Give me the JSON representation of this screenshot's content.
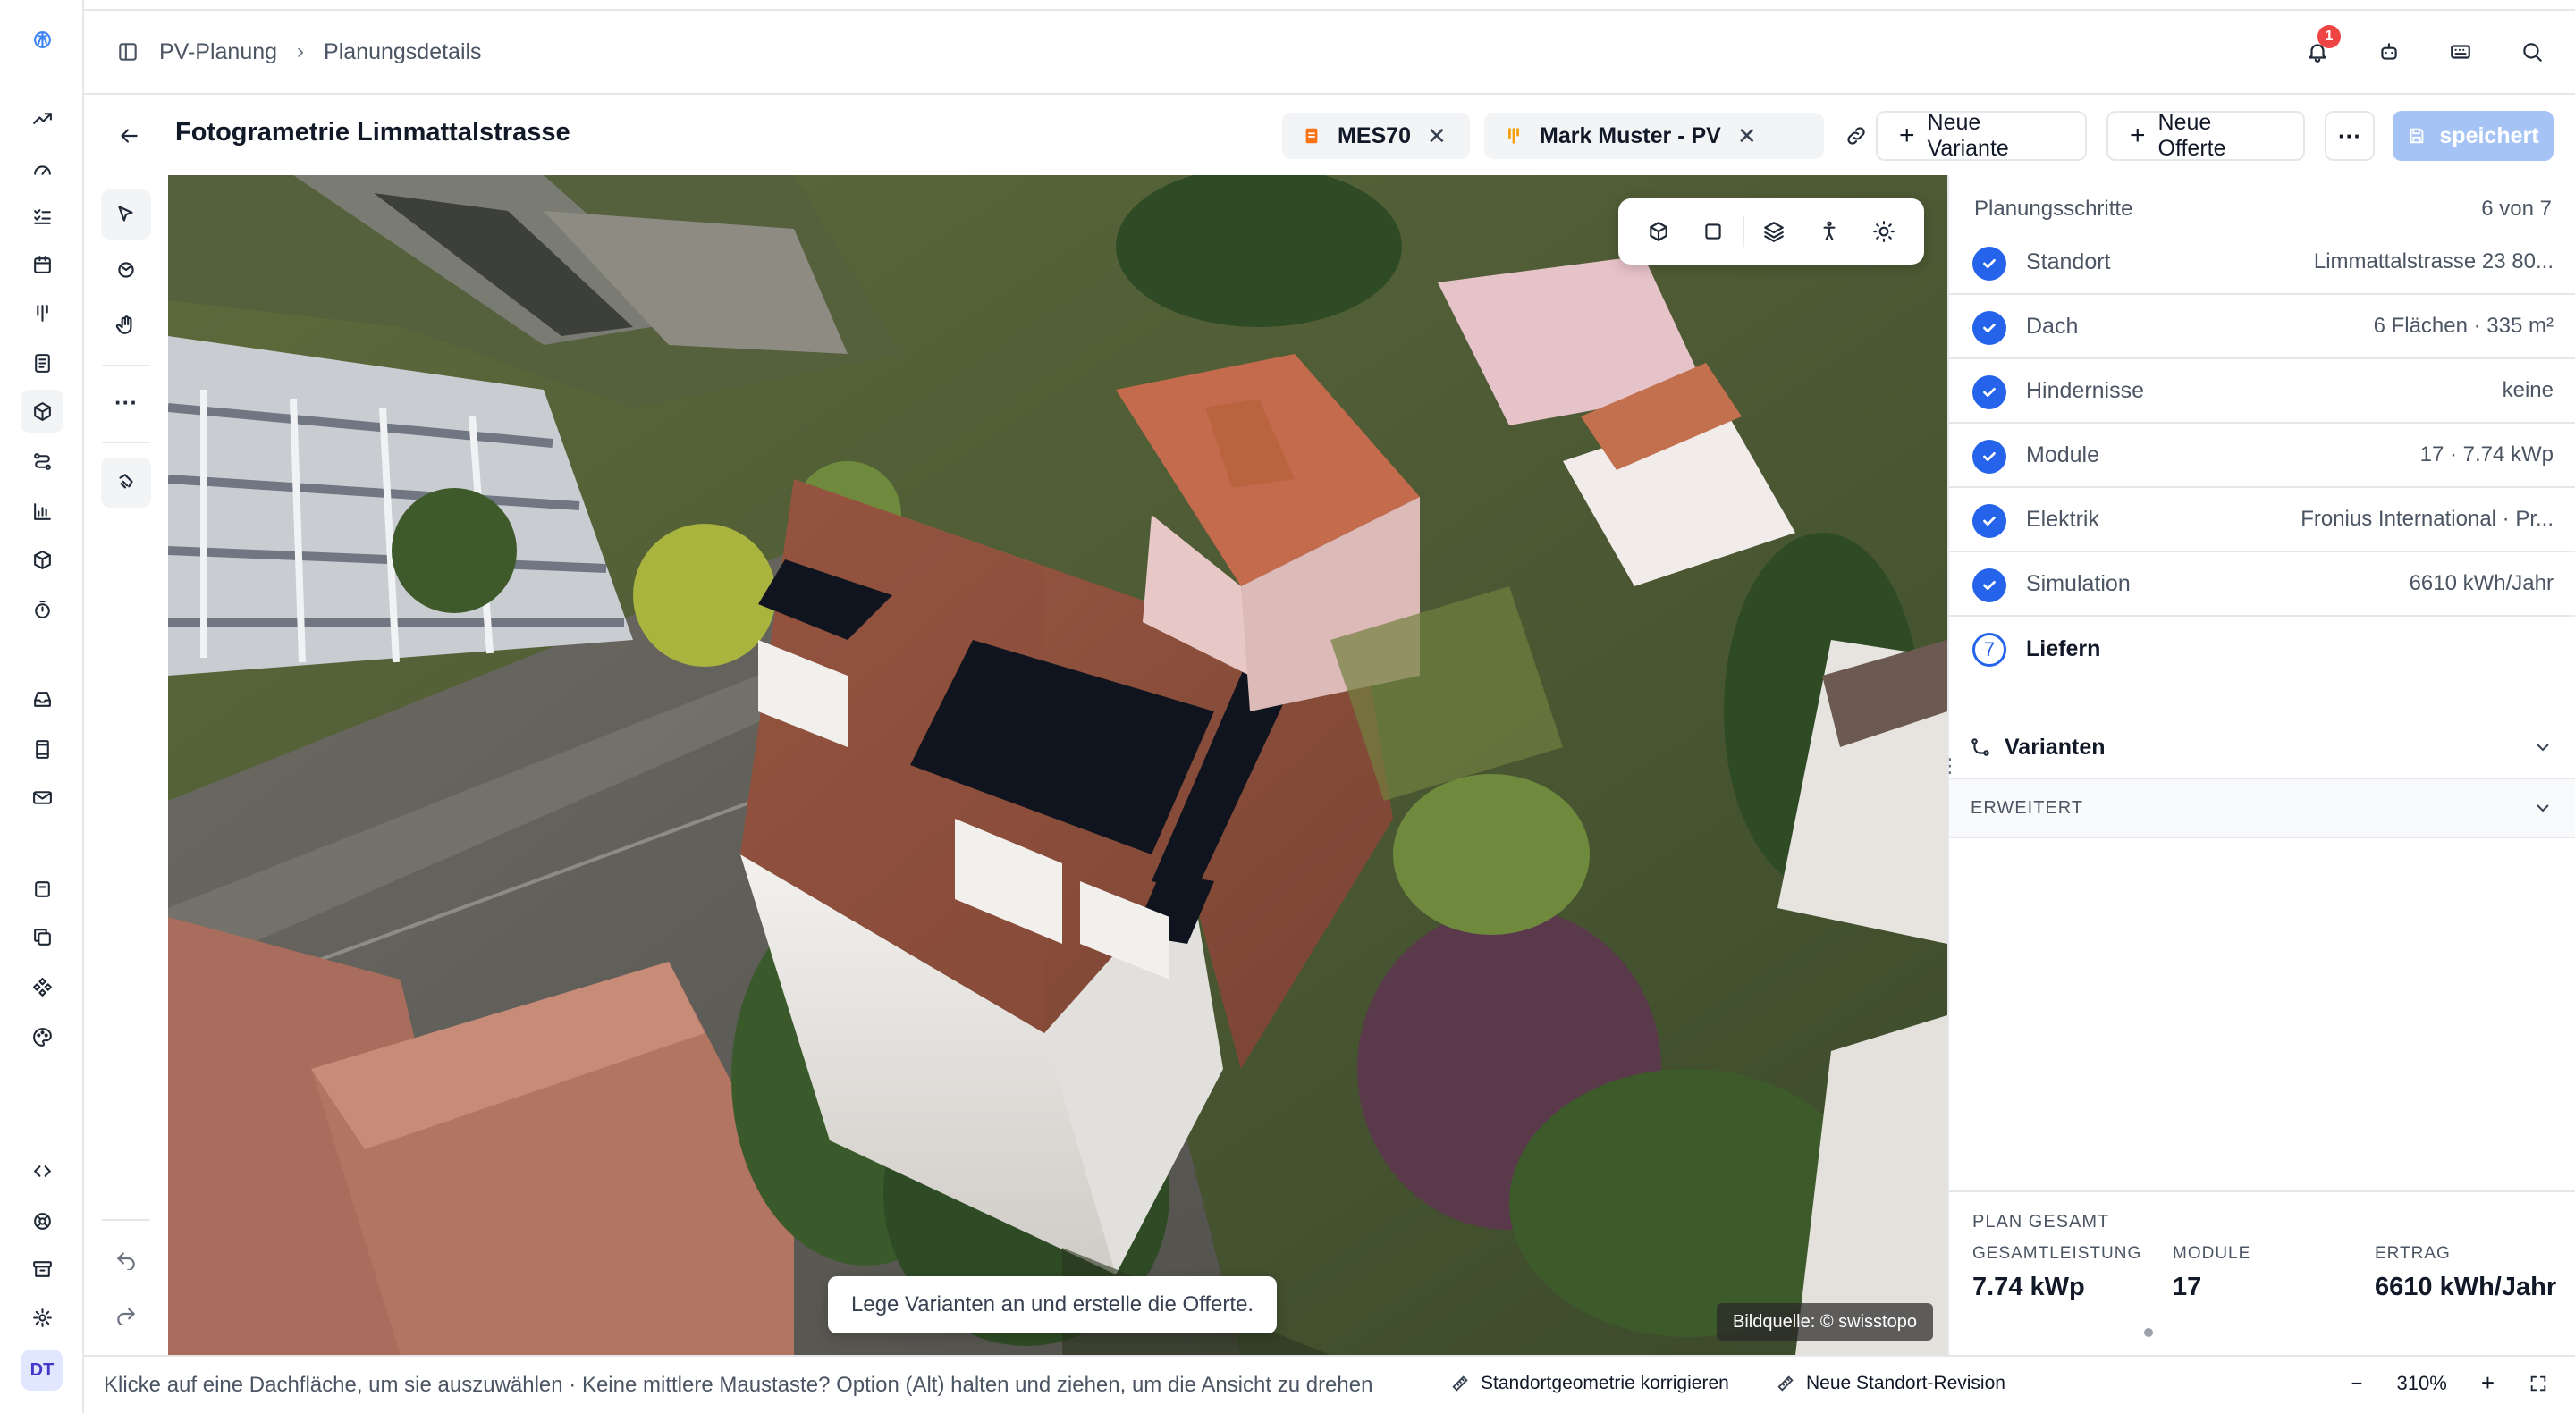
{
  "app": {
    "avatar_initials": "DT",
    "rail_icons": [
      "logo-icon",
      "trend-icon",
      "gauge-icon",
      "checklist-icon",
      "calendar-icon",
      "kanban-icon",
      "invoice-icon",
      "cube-icon",
      "route-icon",
      "chart-icon",
      "package-icon",
      "timer-icon",
      "inbox-icon",
      "film-icon",
      "mail-icon",
      "archive-box-icon",
      "copy-icon",
      "components-icon",
      "palette-icon",
      "code-icon",
      "help-icon",
      "archive-icon",
      "settings-icon"
    ]
  },
  "breadcrumb": {
    "items": [
      "PV-Planung",
      "Planungsdetails"
    ],
    "notification_count": "1"
  },
  "titlebar": {
    "title": "Fotogrametrie Limmattalstrasse",
    "chips": [
      {
        "label": "MES70"
      },
      {
        "label": "Mark Muster - PV"
      }
    ],
    "new_variant_label": "Neue Variante",
    "new_offer_label": "Neue Offerte",
    "more_label": "···",
    "save_label": "speichert"
  },
  "viewport": {
    "hint": "Lege Varianten an und erstelle die Offerte.",
    "credit": "Bildquelle: © swisstopo"
  },
  "panel": {
    "steps_title": "Planungsschritte",
    "steps_progress": "6 von 7",
    "steps": [
      {
        "label": "Standort",
        "value": "Limmattalstrasse 23 80..."
      },
      {
        "label": "Dach",
        "value": "6 Flächen · 335 m²"
      },
      {
        "label": "Hindernisse",
        "value": "keine"
      },
      {
        "label": "Module",
        "value": "17 · 7.74 kWp"
      },
      {
        "label": "Elektrik",
        "value": "Fronius International · Pr..."
      },
      {
        "label": "Simulation",
        "value": "6610 kWh/Jahr"
      }
    ],
    "current_step": {
      "number": "7",
      "label": "Liefern"
    },
    "variants_label": "Varianten",
    "advanced_label": "ERWEITERT",
    "summary": {
      "title": "PLAN GESAMT",
      "total_power_label": "GESAMTLEISTUNG",
      "total_power_value": "7.74 kWp",
      "modules_label": "MODULE",
      "modules_value": "17",
      "yield_label": "ERTRAG",
      "yield_value": "6610 kWh/Jahr"
    }
  },
  "statusbar": {
    "hint": "Klicke auf eine Dachfläche, um sie auszuwählen · Keine mittlere Maustaste? Option (Alt) halten und ziehen, um die Ansicht zu drehen",
    "fix_geometry_label": "Standortgeometrie korrigieren",
    "new_revision_label": "Neue Standort-Revision",
    "zoom_minus": "−",
    "zoom_level": "310%",
    "zoom_plus": "+"
  },
  "colors": {
    "accent": "#2563eb",
    "save_disabled": "#a5c4f5",
    "badge": "#ef4444"
  }
}
